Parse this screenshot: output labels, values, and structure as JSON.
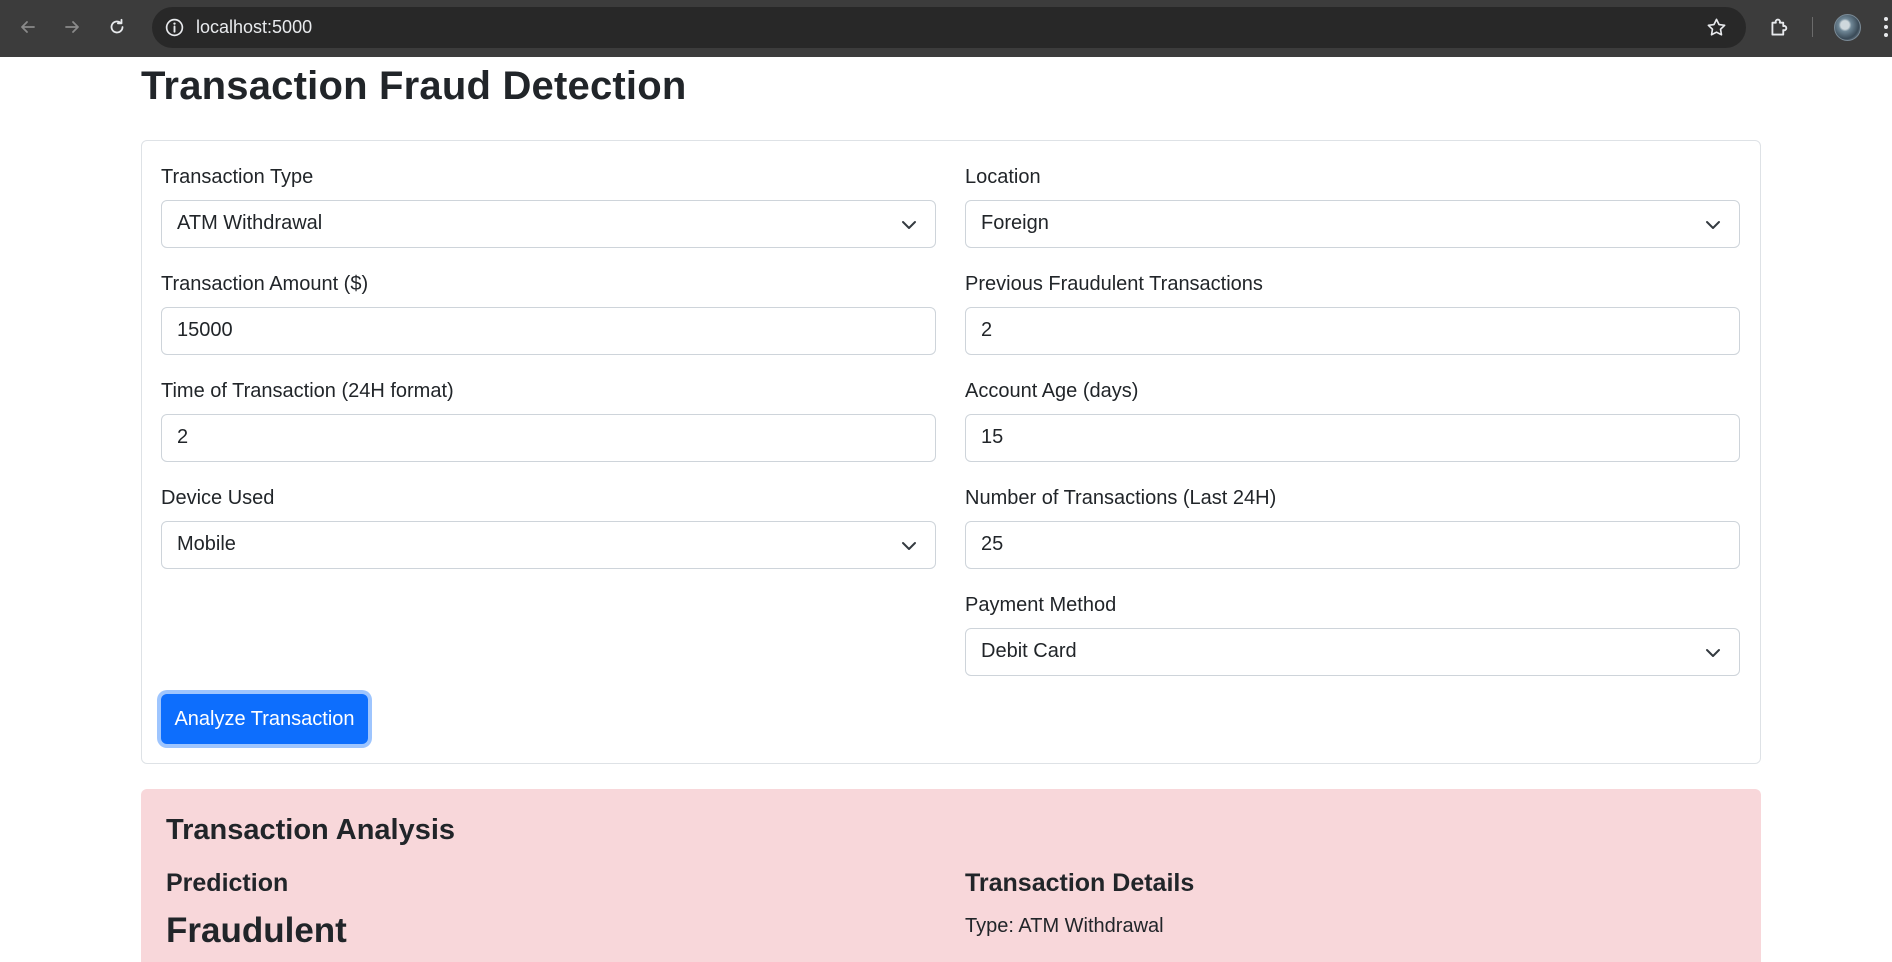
{
  "browser": {
    "url": "localhost:5000"
  },
  "page": {
    "title": "Transaction Fraud Detection"
  },
  "form": {
    "transaction_type": {
      "label": "Transaction Type",
      "value": "ATM Withdrawal"
    },
    "location": {
      "label": "Location",
      "value": "Foreign"
    },
    "amount": {
      "label": "Transaction Amount ($)",
      "value": "15000"
    },
    "prev_fraud": {
      "label": "Previous Fraudulent Transactions",
      "value": "2"
    },
    "time": {
      "label": "Time of Transaction (24H format)",
      "value": "2"
    },
    "account_age": {
      "label": "Account Age (days)",
      "value": "15"
    },
    "device": {
      "label": "Device Used",
      "value": "Mobile"
    },
    "num_transactions": {
      "label": "Number of Transactions (Last 24H)",
      "value": "25"
    },
    "payment_method": {
      "label": "Payment Method",
      "value": "Debit Card"
    },
    "submit_label": "Analyze Transaction"
  },
  "result": {
    "title": "Transaction Analysis",
    "prediction_heading": "Prediction",
    "prediction_value": "Fraudulent",
    "details_heading": "Transaction Details",
    "type_label": "Type:",
    "type_value": "ATM Withdrawal",
    "background_color": "#f8d7da"
  },
  "icons": {
    "back": "arrow-left-icon",
    "forward": "arrow-right-icon",
    "reload": "reload-icon",
    "site_info": "info-icon",
    "bookmark": "star-icon",
    "extensions": "puzzle-icon",
    "profile": "avatar",
    "menu": "kebab-menu-icon",
    "dropdown": "chevron-down-icon"
  },
  "colors": {
    "primary": "#0d6efd",
    "danger_bg": "#f8d7da"
  }
}
